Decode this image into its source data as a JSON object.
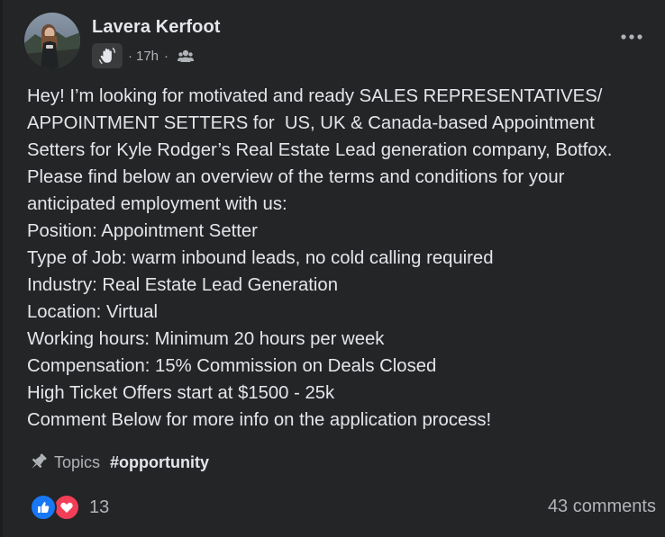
{
  "post": {
    "author": "Lavera Kerfoot",
    "badge_icon": "welcome-wave-hand-icon",
    "time": "17h",
    "separator": "·",
    "audience_icon": "group-members-icon",
    "more_icon": "more-options-icon",
    "body_lines": [
      "Hey! I’m looking for motivated and ready SALES REPRESENTATIVES/",
      "APPOINTMENT SETTERS for  US, UK & Canada-based Appointment",
      "Setters for Kyle Rodger’s Real Estate Lead generation company, Botfox.",
      "Please find below an overview of the terms and conditions for your",
      "anticipated employment with us:",
      "Position: Appointment Setter",
      "Type of Job: warm inbound leads, no cold calling required",
      "Industry: Real Estate Lead Generation",
      "Location: Virtual",
      "Working hours: Minimum 20 hours per week",
      "Compensation: 15% Commission on Deals Closed",
      "High Ticket Offers start at $1500 - 25k",
      "Comment Below for more info on the application process!"
    ],
    "topics_label": "Topics",
    "topic_tag": "#opportunity",
    "reaction_count": "13",
    "comments_label": "43 comments"
  },
  "colors": {
    "background": "#242526",
    "text_primary": "#e4e6eb",
    "text_secondary": "#b0b3b8",
    "like_blue": "#1877f2",
    "love_red": "#f33e58"
  }
}
